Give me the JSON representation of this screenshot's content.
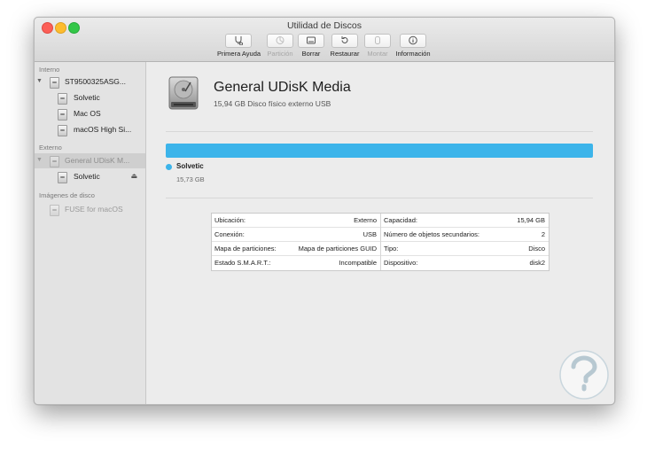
{
  "window": {
    "title": "Utilidad de Discos"
  },
  "toolbar": {
    "buttons": [
      {
        "label": "Primera Ayuda",
        "icon": "stethoscope-icon",
        "enabled": true
      },
      {
        "label": "Partición",
        "icon": "pie-partition-icon",
        "enabled": false
      },
      {
        "label": "Borrar",
        "icon": "erase-drive-icon",
        "enabled": true
      },
      {
        "label": "Restaurar",
        "icon": "restore-arrow-icon",
        "enabled": true
      },
      {
        "label": "Montar",
        "icon": "mount-icon",
        "enabled": false
      },
      {
        "label": "Información",
        "icon": "info-icon",
        "enabled": true
      }
    ]
  },
  "sidebar": {
    "sections": [
      {
        "heading": "Interno"
      },
      {
        "heading": "Externo"
      },
      {
        "heading": "Imágenes de disco"
      }
    ],
    "items": [
      {
        "label": "ST9500325ASG...",
        "type": "disk"
      },
      {
        "label": "Solvetic",
        "type": "volume"
      },
      {
        "label": "Mac OS",
        "type": "volume"
      },
      {
        "label": "macOS High Si...",
        "type": "volume"
      },
      {
        "label": "General UDisK M...",
        "type": "disk",
        "selected": true
      },
      {
        "label": "Solvetic",
        "type": "volume",
        "eject": "⏏"
      },
      {
        "label": "FUSE for macOS",
        "type": "image",
        "disabled": true
      }
    ]
  },
  "main": {
    "disk_name": "General UDisK Media",
    "disk_subtitle": "15,94 GB Disco físico externo USB",
    "usage": {
      "color": "#3cb4ea",
      "fill_fraction": 1.0,
      "volume_name": "Solvetic",
      "volume_size": "15,73 GB"
    },
    "info_left": [
      {
        "key": "Ubicación:",
        "value": "Externo"
      },
      {
        "key": "Conexión:",
        "value": "USB"
      },
      {
        "key": "Mapa de particiones:",
        "value": "Mapa de particiones GUID"
      },
      {
        "key": "Estado S.M.A.R.T.:",
        "value": "Incompatible"
      }
    ],
    "info_right": [
      {
        "key": "Capacidad:",
        "value": "15,94 GB"
      },
      {
        "key": "Número de objetos secundarios:",
        "value": "2"
      },
      {
        "key": "Tipo:",
        "value": "Disco"
      },
      {
        "key": "Dispositivo:",
        "value": "disk2"
      }
    ]
  },
  "colors": {
    "accent": "#3cb4ea",
    "close": "#fc5f57",
    "minimize": "#fdbc2e",
    "maximize": "#33c748"
  }
}
